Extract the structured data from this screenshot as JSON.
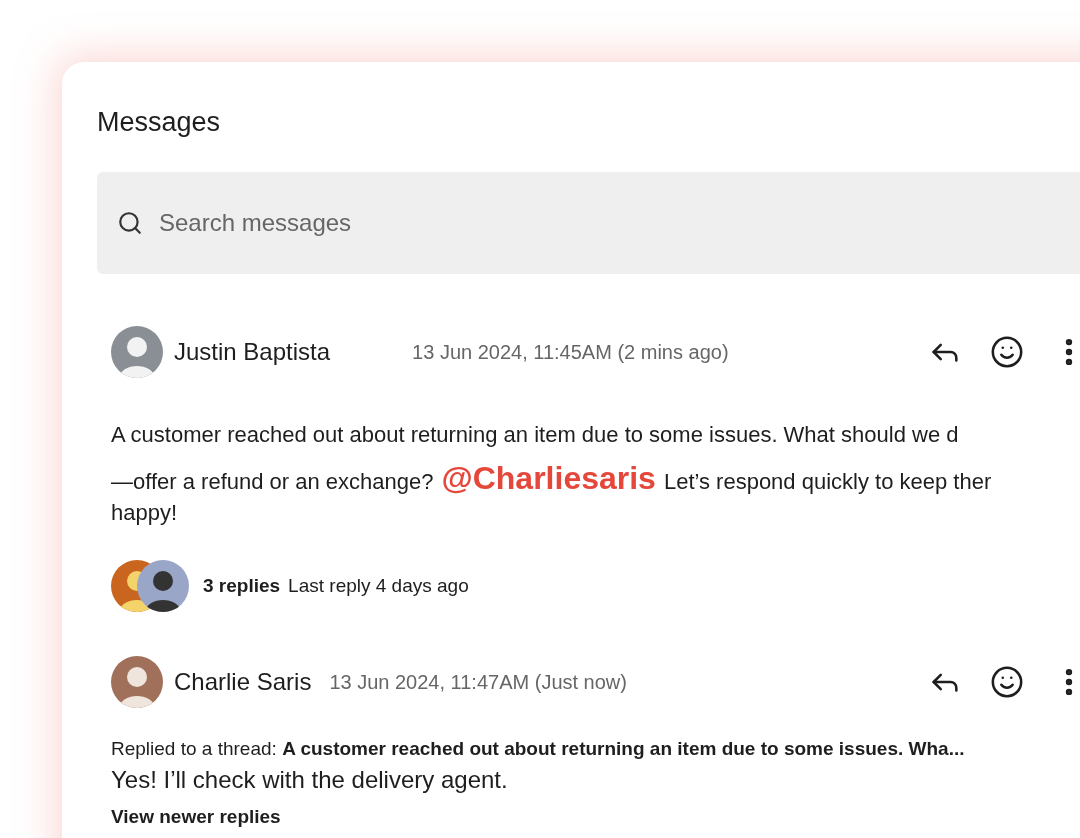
{
  "title": "Messages",
  "search": {
    "placeholder": "Search messages"
  },
  "messages": [
    {
      "author": "Justin Baptista",
      "time": "13 Jun 2024, 11:45AM (2 mins ago)",
      "body": {
        "line_1": "A customer reached out about returning an item due to some issues. What should we d",
        "line_2_before": "—offer a refund or an exchange?",
        "mention": "@Charliesaris",
        "line_2_after": "Let’s respond quickly to keep ther",
        "line_3": "happy!"
      },
      "thread": {
        "count": "3 replies",
        "last": "Last reply 4 days ago"
      }
    },
    {
      "author": "Charlie Saris",
      "time": "13 Jun 2024, 11:47AM (Just now)",
      "replied_label": "Replied to a thread:",
      "replied_quote": "A customer reached out about returning an item due to  some issues. Wha...",
      "reply": "Yes! I’ll check with the delivery agent.",
      "more": "View newer replies"
    }
  ]
}
